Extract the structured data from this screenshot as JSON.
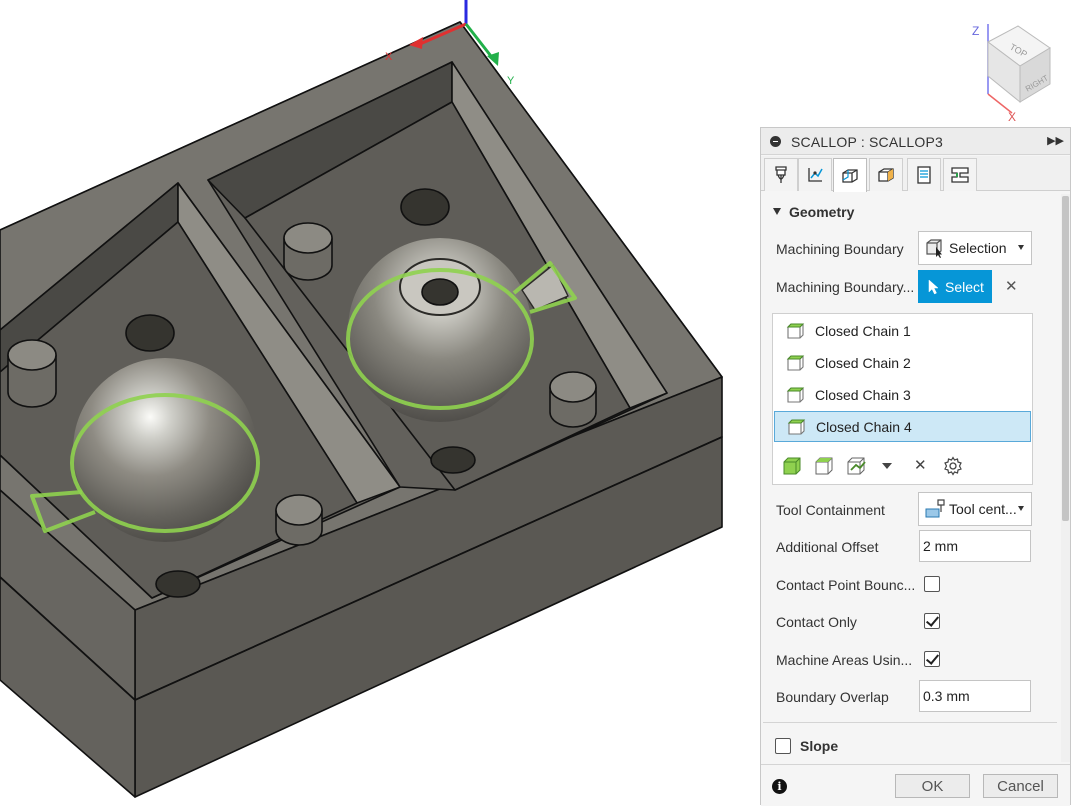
{
  "viewcube": {
    "top_label": "TOP",
    "right_label": "RIGHT",
    "axis_z": "Z",
    "axis_x": "X"
  },
  "scene_axes": {
    "x": "X",
    "y": "Y"
  },
  "panel": {
    "title": "SCALLOP : SCALLOP3",
    "section_geometry": "Geometry",
    "rows": {
      "machining_boundary_label": "Machining Boundary",
      "machining_boundary_value": "Selection",
      "boundary_select_label": "Machining Boundary...",
      "select_button": "Select",
      "tool_containment_label": "Tool Containment",
      "tool_containment_value": "Tool cent...",
      "additional_offset_label": "Additional Offset",
      "additional_offset_value": "2 mm",
      "contact_point_label": "Contact Point Bounc...",
      "contact_only_label": "Contact Only",
      "machine_areas_label": "Machine Areas Usin...",
      "boundary_overlap_label": "Boundary Overlap",
      "boundary_overlap_value": "0.3 mm"
    },
    "checkboxes": {
      "contact_point": false,
      "contact_only": true,
      "machine_areas": true,
      "slope": false
    },
    "chains": [
      "Closed Chain 1",
      "Closed Chain 2",
      "Closed Chain 3",
      "Closed Chain 4"
    ],
    "selected_chain_index": 3,
    "section_slope": "Slope",
    "ok": "OK",
    "cancel": "Cancel",
    "info": "i"
  },
  "colors": {
    "accent": "#0696d7",
    "selection_bg": "#cde8f6",
    "chain_green": "#7fc24a",
    "axis_x": "#e03030",
    "axis_y": "#22b04a",
    "axis_z": "#2a2ae0"
  }
}
